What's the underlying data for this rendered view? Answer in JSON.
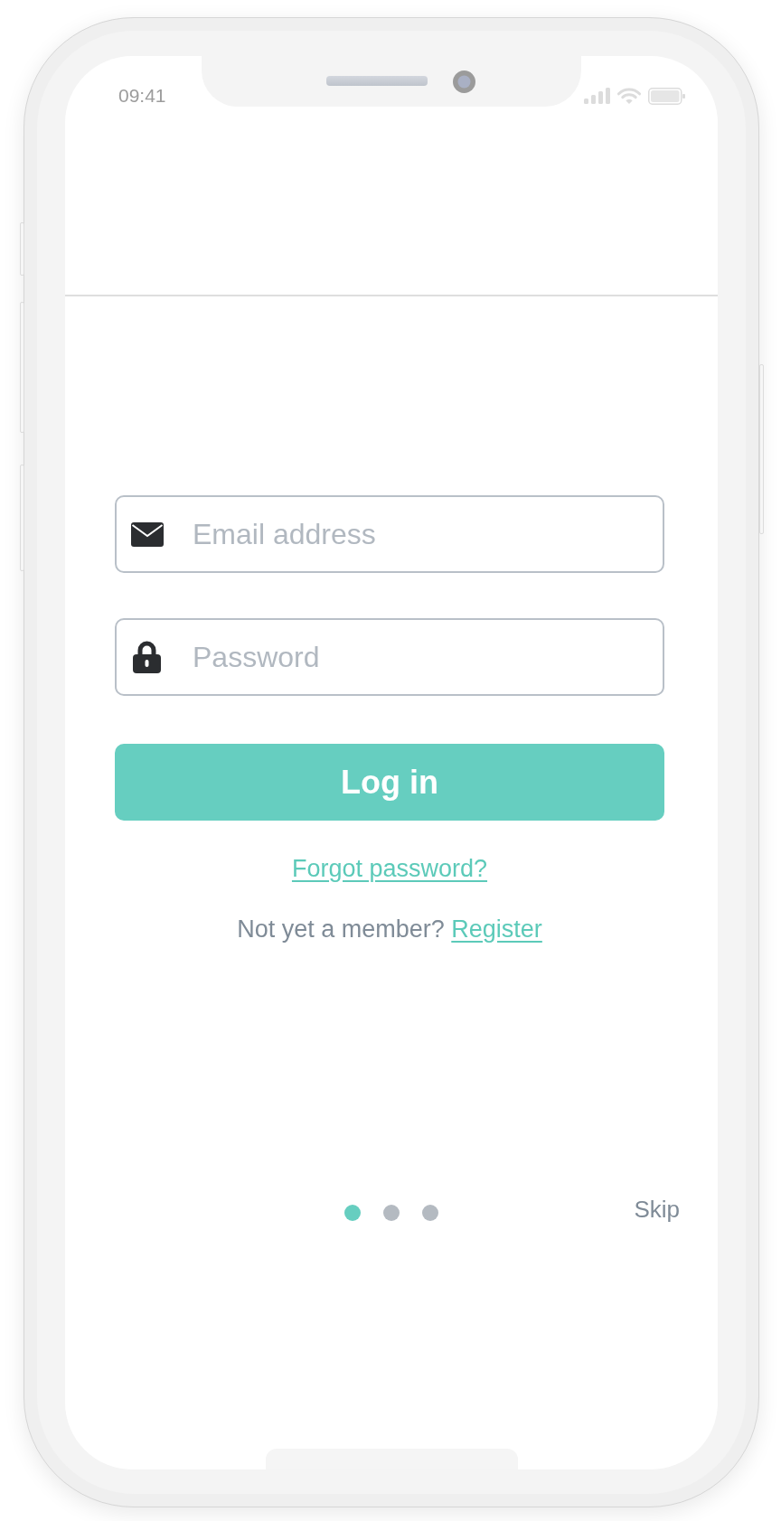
{
  "status_bar": {
    "time": "09:41"
  },
  "form": {
    "fields": [
      {
        "kind": "email",
        "placeholder": "Email address"
      },
      {
        "kind": "password",
        "placeholder": "Password"
      }
    ],
    "login_button": "Log in",
    "forgot_link": "Forgot password?",
    "register_prompt": {
      "text": "Not yet a member?",
      "link": "Register"
    }
  },
  "pager": {
    "dots": [
      {
        "selected": true
      },
      {
        "selected": false
      },
      {
        "selected": false
      }
    ],
    "skip": "Skip"
  }
}
